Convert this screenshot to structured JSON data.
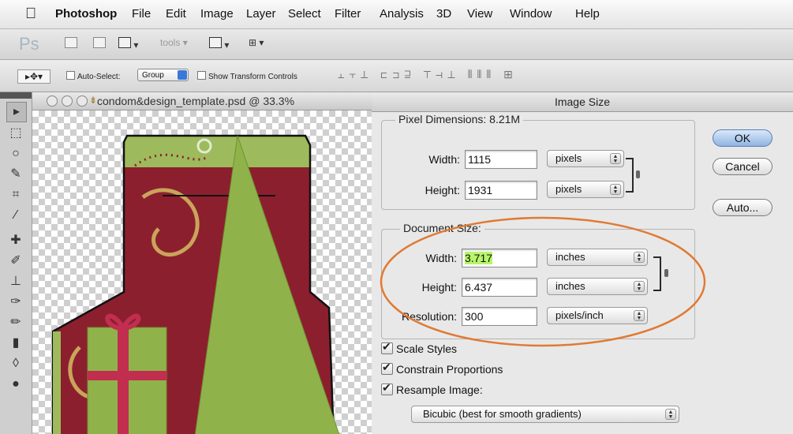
{
  "menubar": {
    "app_name": "Photoshop",
    "items": [
      "File",
      "Edit",
      "Image",
      "Layer",
      "Select",
      "Filter",
      "Analysis",
      "3D",
      "View",
      "Window",
      "Help"
    ]
  },
  "appbar": {
    "logo": "Ps",
    "tools_label": "tools"
  },
  "options_bar": {
    "auto_select_label": "Auto-Select:",
    "auto_select_value": "Group",
    "show_transform_label": "Show Transform Controls"
  },
  "document": {
    "title": "condom&design_template.psd @ 33.3%"
  },
  "dialog": {
    "title": "Image Size",
    "pixel_dimensions": {
      "legend": "Pixel Dimensions:",
      "size": "8.21M",
      "width_label": "Width:",
      "width_value": "1115",
      "width_unit": "pixels",
      "height_label": "Height:",
      "height_value": "1931",
      "height_unit": "pixels"
    },
    "document_size": {
      "legend": "Document Size:",
      "width_label": "Width:",
      "width_value": "3.717",
      "width_unit": "inches",
      "height_label": "Height:",
      "height_value": "6.437",
      "height_unit": "inches",
      "resolution_label": "Resolution:",
      "resolution_value": "300",
      "resolution_unit": "pixels/inch"
    },
    "checkboxes": {
      "scale_styles": "Scale Styles",
      "constrain_proportions": "Constrain Proportions",
      "resample_image": "Resample Image:"
    },
    "resample_method": "Bicubic (best for smooth gradients)",
    "buttons": {
      "ok": "OK",
      "cancel": "Cancel",
      "auto": "Auto..."
    }
  },
  "colors": {
    "annotation_ellipse": "#e07a34",
    "highlight": "#b7f56b",
    "design_red": "#8c1f2e",
    "design_green": "#9dbb5c"
  }
}
